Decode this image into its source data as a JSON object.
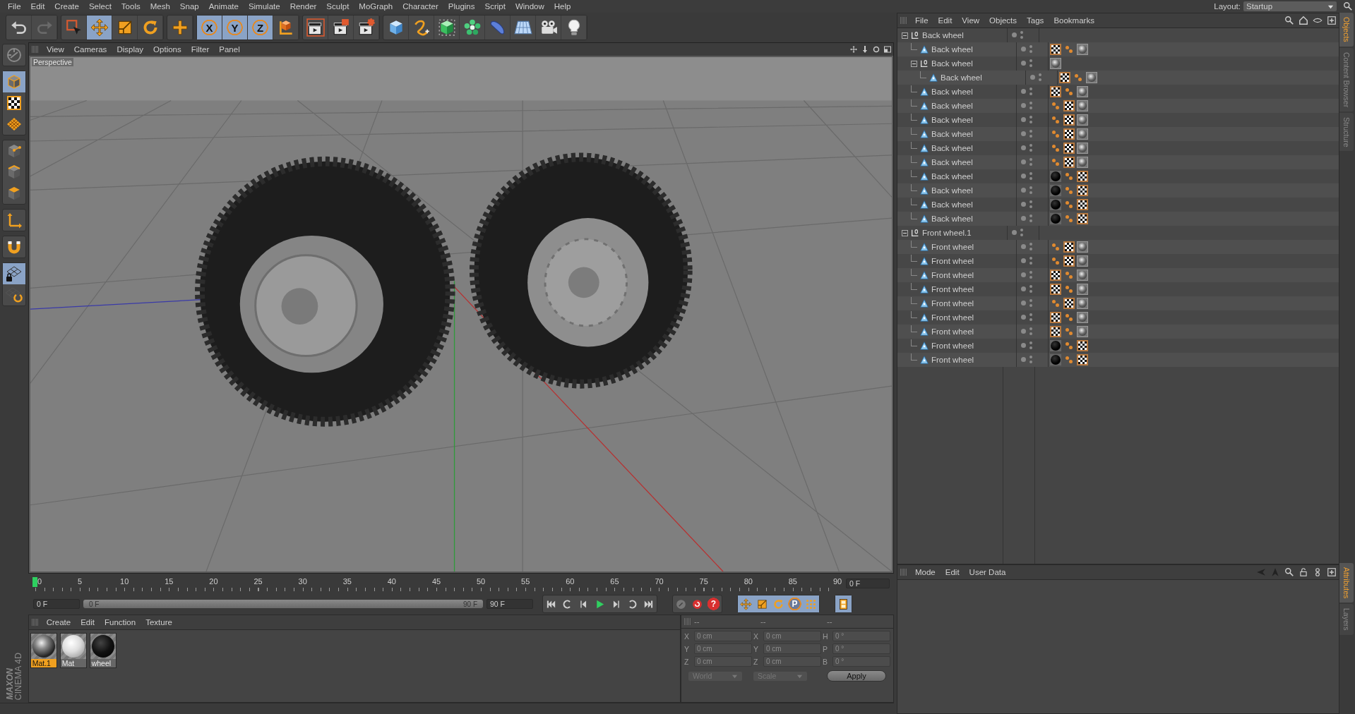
{
  "menu_bar": [
    "File",
    "Edit",
    "Create",
    "Select",
    "Tools",
    "Mesh",
    "Snap",
    "Animate",
    "Simulate",
    "Render",
    "Sculpt",
    "MoGraph",
    "Character",
    "Plugins",
    "Script",
    "Window",
    "Help"
  ],
  "layout": {
    "label": "Layout:",
    "value": "Startup"
  },
  "toolbar": [
    {
      "items": [
        {
          "kind": "undo",
          "selected": false,
          "disabled": false
        },
        {
          "kind": "redo",
          "selected": false,
          "disabled": true
        }
      ]
    },
    {
      "items": [
        {
          "kind": "select",
          "selected": false
        },
        {
          "kind": "move",
          "selected": true
        },
        {
          "kind": "scale",
          "selected": false
        },
        {
          "kind": "rotate",
          "selected": false
        }
      ]
    },
    {
      "items": [
        {
          "kind": "add",
          "selected": false
        }
      ]
    },
    {
      "items": [
        {
          "kind": "axis",
          "label": "X",
          "selected": true
        },
        {
          "kind": "axis",
          "label": "Y",
          "selected": true
        },
        {
          "kind": "axis",
          "label": "Z",
          "selected": true
        },
        {
          "kind": "coord",
          "selected": false
        }
      ]
    },
    {
      "items": [
        {
          "kind": "render-view",
          "selected": false
        },
        {
          "kind": "render",
          "selected": false
        },
        {
          "kind": "render-settings",
          "selected": false
        }
      ]
    },
    {
      "items": [
        {
          "kind": "cube",
          "selected": false
        },
        {
          "kind": "spline",
          "selected": false
        },
        {
          "kind": "nurbs",
          "selected": false
        },
        {
          "kind": "array",
          "selected": false
        },
        {
          "kind": "deformer",
          "selected": false
        },
        {
          "kind": "floor",
          "selected": false
        },
        {
          "kind": "camera",
          "selected": false
        },
        {
          "kind": "light",
          "selected": false
        }
      ]
    }
  ],
  "left_tools": [
    {
      "items": [
        {
          "kind": "navigate",
          "selected": false
        }
      ]
    },
    {
      "items": [
        {
          "kind": "model",
          "selected": true
        },
        {
          "kind": "texture",
          "selected": false
        },
        {
          "kind": "workplane",
          "selected": false
        }
      ]
    },
    {
      "items": [
        {
          "kind": "points",
          "selected": false
        },
        {
          "kind": "edges",
          "selected": false
        },
        {
          "kind": "polygons",
          "selected": false
        }
      ]
    },
    {
      "items": [
        {
          "kind": "axis-tool",
          "selected": false
        }
      ]
    },
    {
      "items": [
        {
          "kind": "magnet",
          "selected": false
        }
      ]
    },
    {
      "items": [
        {
          "kind": "lock-grid",
          "selected": true
        },
        {
          "kind": "grid-snap",
          "selected": false
        }
      ]
    }
  ],
  "viewport": {
    "menu": [
      "View",
      "Cameras",
      "Display",
      "Options",
      "Filter",
      "Panel"
    ],
    "camera": "Perspective"
  },
  "timeline": {
    "ticks": [
      "0",
      "5",
      "10",
      "15",
      "20",
      "25",
      "30",
      "35",
      "40",
      "45",
      "50",
      "55",
      "60",
      "65",
      "70",
      "75",
      "80",
      "85",
      "90"
    ],
    "current_frame": "0 F",
    "playhead": {
      "level": 0
    }
  },
  "transport": {
    "start_field": "0 F",
    "range": {
      "start": "0 F",
      "end": "90 F",
      "level": 1
    },
    "end_field": "90 F",
    "groups": [
      {
        "buttons": [
          {
            "kind": "go-start",
            "selected": false
          },
          {
            "kind": "loop-back",
            "selected": false
          },
          {
            "kind": "step-back",
            "selected": false
          },
          {
            "kind": "play",
            "selected": false
          },
          {
            "kind": "step-forward",
            "selected": false
          },
          {
            "kind": "loop",
            "selected": false
          },
          {
            "kind": "go-end",
            "selected": false
          }
        ]
      },
      {
        "buttons": [
          {
            "kind": "key",
            "selected": false
          },
          {
            "kind": "record",
            "selected": false
          },
          {
            "kind": "help-record",
            "label": "?",
            "selected": false
          }
        ]
      },
      {
        "buttons": [
          {
            "kind": "move",
            "selected": true
          },
          {
            "kind": "scale",
            "selected": true
          },
          {
            "kind": "rotate",
            "selected": true
          },
          {
            "kind": "param",
            "label": "P",
            "selected": true
          },
          {
            "kind": "dots",
            "selected": true
          }
        ]
      },
      {
        "buttons": [
          {
            "kind": "film",
            "selected": true
          }
        ]
      }
    ]
  },
  "materials": {
    "menu": [
      "Create",
      "Edit",
      "Function",
      "Texture"
    ],
    "items": [
      {
        "name": "Mat.1",
        "kind": "chrome",
        "selected": true
      },
      {
        "name": "Mat",
        "kind": "white",
        "selected": false
      },
      {
        "name": "wheel",
        "kind": "black",
        "selected": false
      }
    ]
  },
  "logo": {
    "brand": "MAXON",
    "product": "CINEMA 4D"
  },
  "coordinates": {
    "headers": [
      "--",
      "--",
      "--"
    ],
    "rows": [
      {
        "cells": [
          {
            "label": "X",
            "value": "0 cm",
            "disabled": true
          },
          {
            "label": "X",
            "value": "0 cm",
            "disabled": true
          },
          {
            "label": "H",
            "value": "0 °",
            "disabled": true
          }
        ]
      },
      {
        "cells": [
          {
            "label": "Y",
            "value": "0 cm",
            "disabled": true
          },
          {
            "label": "Y",
            "value": "0 cm",
            "disabled": true
          },
          {
            "label": "P",
            "value": "0 °",
            "disabled": true
          }
        ]
      },
      {
        "cells": [
          {
            "label": "Z",
            "value": "0 cm",
            "disabled": true
          },
          {
            "label": "Z",
            "value": "0 cm",
            "disabled": true
          },
          {
            "label": "B",
            "value": "0 °",
            "disabled": true
          }
        ]
      }
    ],
    "dropdowns": [
      "World",
      "Scale"
    ],
    "apply": "Apply"
  },
  "object_manager": {
    "menu": [
      "File",
      "Edit",
      "View",
      "Objects",
      "Tags",
      "Bookmarks"
    ],
    "objects": [
      {
        "name": "Back wheel",
        "kind": "null",
        "expanded": true,
        "children": [
          {
            "name": "Back wheel",
            "kind": "polygon",
            "tags": [
              {
                "kind": "checker"
              },
              {
                "kind": "dots"
              },
              {
                "kind": "sphere"
              }
            ]
          },
          {
            "name": "Back wheel",
            "kind": "null",
            "expanded": true,
            "tags": [
              {
                "kind": "sphere"
              }
            ],
            "children": [
              {
                "name": "Back wheel",
                "kind": "polygon",
                "tags": [
                  {
                    "kind": "checker"
                  },
                  {
                    "kind": "dots"
                  },
                  {
                    "kind": "sphere"
                  }
                ]
              }
            ]
          },
          {
            "name": "Back wheel",
            "kind": "polygon",
            "tags": [
              {
                "kind": "checker"
              },
              {
                "kind": "dots"
              },
              {
                "kind": "sphere"
              }
            ]
          },
          {
            "name": "Back wheel",
            "kind": "polygon",
            "tags": [
              {
                "kind": "dots"
              },
              {
                "kind": "checker"
              },
              {
                "kind": "sphere"
              }
            ]
          },
          {
            "name": "Back wheel",
            "kind": "polygon",
            "tags": [
              {
                "kind": "dots"
              },
              {
                "kind": "checker"
              },
              {
                "kind": "sphere"
              }
            ]
          },
          {
            "name": "Back wheel",
            "kind": "polygon",
            "tags": [
              {
                "kind": "dots"
              },
              {
                "kind": "checker"
              },
              {
                "kind": "sphere"
              }
            ]
          },
          {
            "name": "Back wheel",
            "kind": "polygon",
            "tags": [
              {
                "kind": "dots"
              },
              {
                "kind": "checker"
              },
              {
                "kind": "sphere"
              }
            ]
          },
          {
            "name": "Back wheel",
            "kind": "polygon",
            "tags": [
              {
                "kind": "dots"
              },
              {
                "kind": "checker"
              },
              {
                "kind": "sphere"
              }
            ]
          },
          {
            "name": "Back wheel",
            "kind": "polygon",
            "tags": [
              {
                "kind": "black"
              },
              {
                "kind": "dots"
              },
              {
                "kind": "checker"
              }
            ]
          },
          {
            "name": "Back wheel",
            "kind": "polygon",
            "tags": [
              {
                "kind": "black"
              },
              {
                "kind": "dots"
              },
              {
                "kind": "checker"
              }
            ]
          },
          {
            "name": "Back wheel",
            "kind": "polygon",
            "tags": [
              {
                "kind": "black"
              },
              {
                "kind": "dots"
              },
              {
                "kind": "checker"
              }
            ]
          },
          {
            "name": "Back wheel",
            "kind": "polygon",
            "tags": [
              {
                "kind": "black"
              },
              {
                "kind": "dots"
              },
              {
                "kind": "checker"
              }
            ]
          }
        ]
      },
      {
        "name": "Front wheel.1",
        "kind": "null",
        "expanded": true,
        "children": [
          {
            "name": "Front wheel",
            "kind": "polygon",
            "tags": [
              {
                "kind": "dots"
              },
              {
                "kind": "checker"
              },
              {
                "kind": "sphere"
              }
            ]
          },
          {
            "name": "Front wheel",
            "kind": "polygon",
            "tags": [
              {
                "kind": "dots"
              },
              {
                "kind": "checker"
              },
              {
                "kind": "sphere"
              }
            ]
          },
          {
            "name": "Front wheel",
            "kind": "polygon",
            "tags": [
              {
                "kind": "checker"
              },
              {
                "kind": "dots"
              },
              {
                "kind": "sphere"
              }
            ]
          },
          {
            "name": "Front wheel",
            "kind": "polygon",
            "tags": [
              {
                "kind": "checker"
              },
              {
                "kind": "dots"
              },
              {
                "kind": "sphere"
              }
            ]
          },
          {
            "name": "Front wheel",
            "kind": "polygon",
            "tags": [
              {
                "kind": "dots"
              },
              {
                "kind": "checker"
              },
              {
                "kind": "sphere"
              }
            ]
          },
          {
            "name": "Front wheel",
            "kind": "polygon",
            "tags": [
              {
                "kind": "checker"
              },
              {
                "kind": "dots"
              },
              {
                "kind": "sphere"
              }
            ]
          },
          {
            "name": "Front wheel",
            "kind": "polygon",
            "tags": [
              {
                "kind": "checker"
              },
              {
                "kind": "dots"
              },
              {
                "kind": "sphere"
              }
            ]
          },
          {
            "name": "Front wheel",
            "kind": "polygon",
            "tags": [
              {
                "kind": "black"
              },
              {
                "kind": "dots"
              },
              {
                "kind": "checker"
              }
            ]
          },
          {
            "name": "Front wheel",
            "kind": "polygon",
            "tags": [
              {
                "kind": "black"
              },
              {
                "kind": "dots"
              },
              {
                "kind": "checker"
              }
            ]
          }
        ]
      }
    ]
  },
  "attributes": {
    "menu": [
      "Mode",
      "Edit",
      "User Data"
    ]
  },
  "side_tabs": {
    "top": [
      {
        "label": "Objects",
        "selected": true
      },
      {
        "label": "Content Browser",
        "selected": false
      },
      {
        "label": "Structure",
        "selected": false
      }
    ],
    "bottom": [
      {
        "label": "Attributes",
        "selected": true
      },
      {
        "label": "Layers",
        "selected": false
      }
    ]
  }
}
